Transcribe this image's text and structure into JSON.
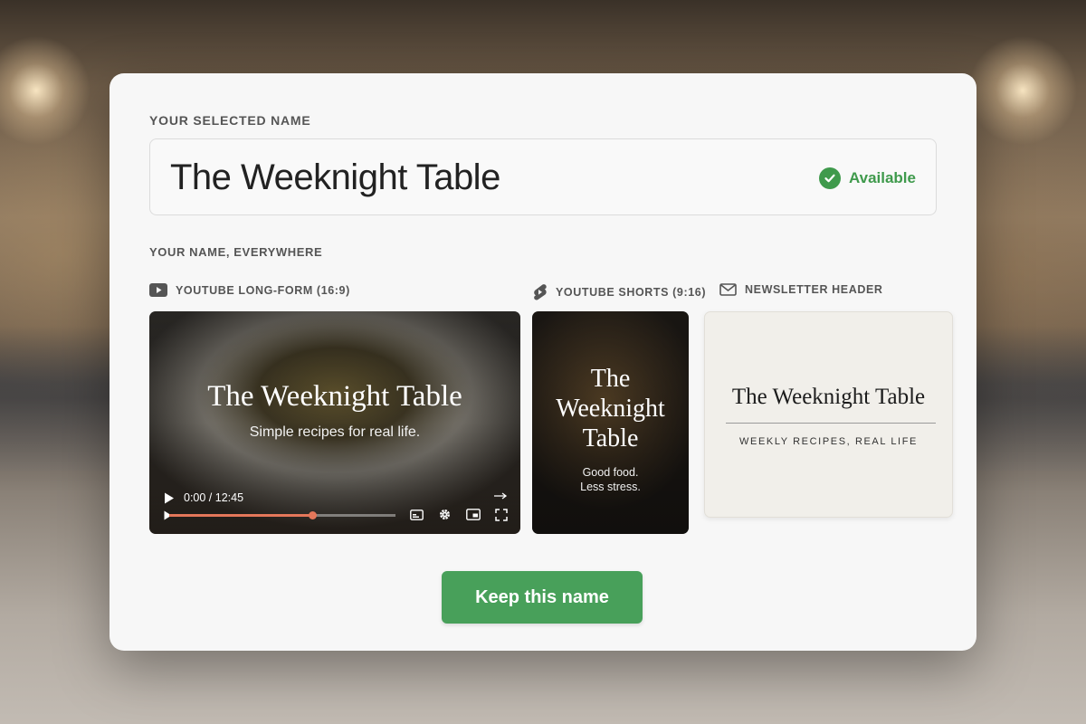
{
  "selected": {
    "label": "YOUR SELECTED NAME",
    "name": "The Weeknight Table",
    "status": "Available",
    "status_color": "#3f9a4c"
  },
  "previews": {
    "label": "YOUR NAME, EVERYWHERE",
    "long_form": {
      "label": "YOUTUBE LONG-FORM (16:9)",
      "icon": "youtube-icon",
      "title": "The Weeknight Table",
      "subtitle": "Simple recipes for real life.",
      "time": "0:00 / 12:45",
      "progress": 0.63,
      "progress_color": "#e4775a"
    },
    "shorts": {
      "label": "YOUTUBE SHORTS (9:16)",
      "icon": "youtube-shorts-icon",
      "title": "The Weeknight Table",
      "tagline_1": "Good food.",
      "tagline_2": "Less stress."
    },
    "newsletter": {
      "label": "NEWSLETTER HEADER",
      "icon": "mail-icon",
      "title": "The Weeknight Table",
      "subtitle": "WEEKLY RECIPES, REAL LIFE"
    }
  },
  "actions": {
    "keep_label": "Keep this name",
    "keep_color": "#48a05a"
  }
}
